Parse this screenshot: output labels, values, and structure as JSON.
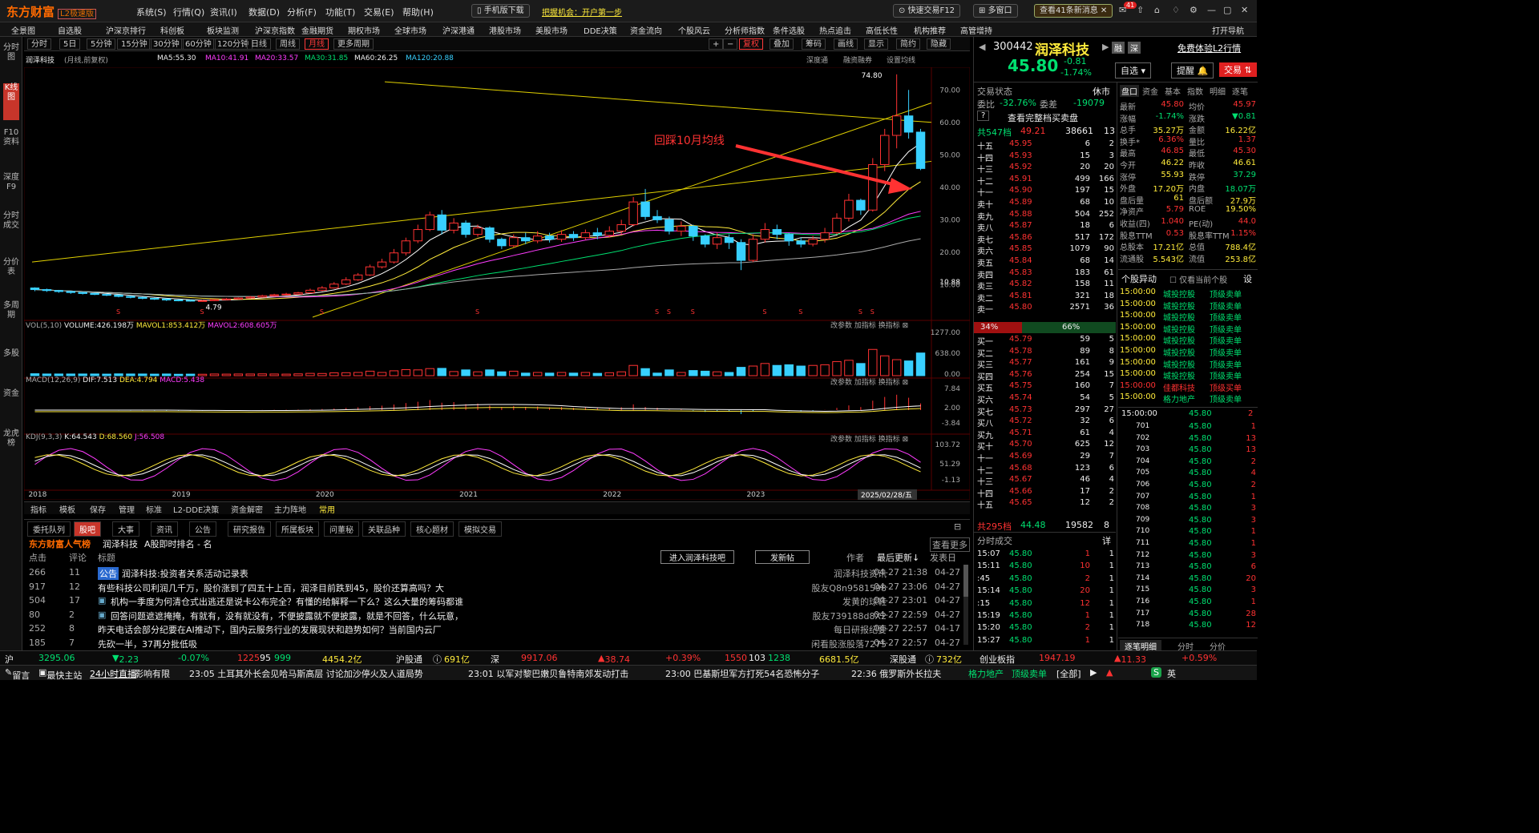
{
  "app": {
    "logo": "东方财富",
    "edition": "L2极速版"
  },
  "menus": [
    "系统(S)",
    "行情(Q)",
    "资讯(I)",
    "数据(D)",
    "分析(F)",
    "功能(T)",
    "交易(E)",
    "帮助(H)"
  ],
  "title_buttons": {
    "mobile": "手机版下载",
    "promo": "把握机会：开户第一步",
    "quick": "快速交易F12",
    "multiwin": "多窗口",
    "news": "查看41条新消息",
    "badge": "41"
  },
  "nav": [
    "全景图",
    "自选股",
    "沪深京排行",
    "科创板",
    "板块监测",
    "沪深京指数",
    "金融期货",
    "期权市场",
    "全球市场",
    "沪深港通",
    "港股市场",
    "美股市场",
    "DDE决策",
    "资金流向",
    "个股风云",
    "分析师指数",
    "条件选股",
    "热点追击",
    "高低长性",
    "机构推荐",
    "高管增持",
    "打开导航"
  ],
  "leftnav": [
    "分时图",
    "K线图",
    "F10资料",
    "深度F9",
    "分时成交",
    "分价表",
    "多周期",
    "多股",
    "资金",
    "龙虎榜"
  ],
  "periods": [
    "分时",
    "5日",
    "5分钟",
    "15分钟",
    "30分钟",
    "60分钟",
    "120分钟",
    "日线",
    "周线",
    "月线",
    "更多周期"
  ],
  "chart_tools": [
    "复权",
    "叠加",
    "筹码",
    "画线",
    "显示",
    "简约",
    "隐藏"
  ],
  "chart_sub_links": [
    "深度通",
    "融资融券",
    "设置均线"
  ],
  "ma_header": {
    "name": "润泽科技",
    "mode": "(月线,前复权)",
    "ma5": "MA5:55.30",
    "ma10": "MA10:41.91",
    "ma20": "MA20:33.57",
    "ma30": "MA30:31.85",
    "ma60": "MA60:26.25",
    "ma120": "MA120:20.88"
  },
  "vol_header": {
    "name": "VOL(5,10)",
    "vol": "VOLUME:426.198万",
    "m1": "MAVOL1:853.412万",
    "m2": "MAVOL2:608.605万"
  },
  "macd_header": {
    "name": "MACD(12,26,9)",
    "dif": "DIF:7.513",
    "dea": "DEA:4.794",
    "macd": "MACD:5.438"
  },
  "kdj_header": {
    "name": "KDJ(9,3,3)",
    "k": "K:64.543",
    "d": "D:68.560",
    "j": "J:56.508"
  },
  "panel_links": [
    "改参数",
    "加指标",
    "换指标"
  ],
  "annotation": "回踩10月均线",
  "high_label": "74.80",
  "low_label": "4.79",
  "price_axis": [
    "70.00",
    "60.00",
    "50.00",
    "40.00",
    "30.00",
    "20.00",
    "10.88",
    "10.00"
  ],
  "vol_axis": [
    "1277.00",
    "638.00",
    "0.00"
  ],
  "macd_axis": [
    "7.84",
    "2.00",
    "-3.84"
  ],
  "kdj_axis": [
    "103.72",
    "51.29",
    "-1.13"
  ],
  "years": [
    "2018",
    "2019",
    "2020",
    "2021",
    "2022",
    "2023",
    "2024"
  ],
  "cursor_date": "2025/02/28/五",
  "chart_data": {
    "type": "candlestick",
    "series_name": "润泽科技 月线",
    "ylim": [
      0,
      75
    ],
    "candles": [
      [
        9,
        8.5,
        9.2,
        8.0
      ],
      [
        8.5,
        8.2,
        8.8,
        7.8
      ],
      [
        8.2,
        7.9,
        8.4,
        7.5
      ],
      [
        7.9,
        7.6,
        8.1,
        7.2
      ],
      [
        7.6,
        7.3,
        7.8,
        7.0
      ],
      [
        7.3,
        7.0,
        7.5,
        6.8
      ],
      [
        7.0,
        6.8,
        7.2,
        6.5
      ],
      [
        6.8,
        6.4,
        7.0,
        6.1
      ],
      [
        6.4,
        6.1,
        6.6,
        5.8
      ],
      [
        6.1,
        5.8,
        6.3,
        5.5
      ],
      [
        5.8,
        5.6,
        6.0,
        5.3
      ],
      [
        5.6,
        5.3,
        5.8,
        5.0
      ],
      [
        5.3,
        5.2,
        5.5,
        4.9
      ],
      [
        5.2,
        5.0,
        5.4,
        4.8
      ],
      [
        5.0,
        5.1,
        5.3,
        4.79
      ],
      [
        5.1,
        5.4,
        5.6,
        5.0
      ],
      [
        5.4,
        5.6,
        5.9,
        5.2
      ],
      [
        5.6,
        5.9,
        6.1,
        5.4
      ],
      [
        5.9,
        6.2,
        6.5,
        5.7
      ],
      [
        6.2,
        6.6,
        6.9,
        6.0
      ],
      [
        6.6,
        6.9,
        7.2,
        6.4
      ],
      [
        6.9,
        7.1,
        7.5,
        6.7
      ],
      [
        7.1,
        7.5,
        7.8,
        6.9
      ],
      [
        7.5,
        8.3,
        8.8,
        7.3
      ],
      [
        8.3,
        9.0,
        9.6,
        8.0
      ],
      [
        9.0,
        10.2,
        10.8,
        8.8
      ],
      [
        10.2,
        11.5,
        12.3,
        9.9
      ],
      [
        11.5,
        13.0,
        13.6,
        11.2
      ],
      [
        13.0,
        15.5,
        16.2,
        12.7
      ],
      [
        15.5,
        17.0,
        18.0,
        15.0
      ],
      [
        17.0,
        19.8,
        21.0,
        16.5
      ],
      [
        19.8,
        23.5,
        24.5,
        19.0
      ],
      [
        23.5,
        27.0,
        28.5,
        22.8
      ],
      [
        27.0,
        31.5,
        32.5,
        26.5
      ],
      [
        31.5,
        26.8,
        33.0,
        25.5
      ],
      [
        26.8,
        29.0,
        30.5,
        25.8
      ],
      [
        29.0,
        25.5,
        29.8,
        24.5
      ],
      [
        25.5,
        27.5,
        28.5,
        24.8
      ],
      [
        27.5,
        24.0,
        28.0,
        23.0
      ],
      [
        24.0,
        22.0,
        24.5,
        21.0
      ],
      [
        22.0,
        24.5,
        25.5,
        21.5
      ],
      [
        24.5,
        23.5,
        26.0,
        22.5
      ],
      [
        23.5,
        25.0,
        26.5,
        22.8
      ],
      [
        25.0,
        24.0,
        26.0,
        23.0
      ],
      [
        24.0,
        25.5,
        26.8,
        23.2
      ],
      [
        25.5,
        24.5,
        26.5,
        23.5
      ],
      [
        24.5,
        26.0,
        27.0,
        23.8
      ],
      [
        26.0,
        25.2,
        27.5,
        24.0
      ],
      [
        25.2,
        26.5,
        28.0,
        24.5
      ],
      [
        26.5,
        28.5,
        30.0,
        25.5
      ],
      [
        28.5,
        35.5,
        37.0,
        28.0
      ],
      [
        35.5,
        31.0,
        39.5,
        30.0
      ],
      [
        31.0,
        30.0,
        33.0,
        29.0
      ],
      [
        30.0,
        26.5,
        31.0,
        25.5
      ],
      [
        26.5,
        28.0,
        29.5,
        25.0
      ],
      [
        28.0,
        25.0,
        28.5,
        23.5
      ],
      [
        25.0,
        22.5,
        25.5,
        21.5
      ],
      [
        22.5,
        24.5,
        26.0,
        21.0
      ],
      [
        24.5,
        23.0,
        25.5,
        21.0
      ],
      [
        23.0,
        17.5,
        24.0,
        14.5
      ],
      [
        17.5,
        24.0,
        25.5,
        17.0
      ],
      [
        24.0,
        27.0,
        29.0,
        23.0
      ],
      [
        27.0,
        25.5,
        28.5,
        24.0
      ],
      [
        25.5,
        23.5,
        26.0,
        22.0
      ],
      [
        23.5,
        22.5,
        24.5,
        21.5
      ],
      [
        22.5,
        24.0,
        25.0,
        21.8
      ],
      [
        24.0,
        26.0,
        27.5,
        23.0
      ],
      [
        26.0,
        30.5,
        32.0,
        25.5
      ],
      [
        30.5,
        36.0,
        38.0,
        29.5
      ],
      [
        36.0,
        33.0,
        36.5,
        31.5
      ],
      [
        33.0,
        47.0,
        49.0,
        32.5
      ],
      [
        47.0,
        56.0,
        58.0,
        45.0
      ],
      [
        56.0,
        62.0,
        74.8,
        52.0
      ],
      [
        62.0,
        57.0,
        70.0,
        55.0
      ],
      [
        57.0,
        45.8,
        58.0,
        45.3
      ]
    ]
  },
  "bottom_tabs": [
    "指标",
    "模板",
    "保存",
    "管理",
    "标准",
    "L2-DDE决策",
    "资金解密",
    "主力阵地",
    "常用"
  ],
  "news_tabs": [
    "委托队列",
    "股吧",
    "大事",
    "资讯",
    "公告",
    "研究报告",
    "所属板块",
    "问董秘",
    "关联品种",
    "核心题材",
    "模拟交易"
  ],
  "news_header": {
    "brand": "东方财富人气榜",
    "stock": "润泽科技",
    "rank": "A股即时排名 - 名",
    "more": "查看更多",
    "enter": "进入润泽科技吧",
    "post": "发新帖",
    "cols": [
      "点击",
      "评论",
      "标题",
      "作者",
      "最后更新↓",
      "发表日"
    ]
  },
  "news": [
    {
      "click": "266",
      "comment": "11",
      "tag": "公告",
      "title": "润泽科技:投资者关系活动记录表",
      "author": "润泽科技资讯",
      "updated": "04-27 21:38",
      "date": "04-27"
    },
    {
      "click": "917",
      "comment": "12",
      "tag": "",
      "title": "有些科技公司利润几千万，股价涨到了四五十上百，润泽目前跌到45，股价还算高吗？大",
      "author": "股友Q8n9581598",
      "updated": "04-27 23:06",
      "date": "04-27"
    },
    {
      "click": "504",
      "comment": "17",
      "tag": "img",
      "title": "机构一季度为何清仓式出逃还是说卡公布完全？有懂的给解释一下么？这么大量的筹码都谁",
      "author": "发黄的球鞋",
      "updated": "04-27 23:01",
      "date": "04-27"
    },
    {
      "click": "80",
      "comment": "2",
      "tag": "img",
      "title": "回答问题遮遮掩掩，有就有，没有就没有，不便披露就不便披露，就是不回答，什么玩意，",
      "author": "股友739188d8X2",
      "updated": "04-27 22:59",
      "date": "04-27"
    },
    {
      "click": "252",
      "comment": "8",
      "tag": "",
      "title": "昨天电话会部分纪要在AI推动下，国内云服务行业的发展现状和趋势如何？当前国内云厂",
      "author": "每日研报纪要",
      "updated": "04-27 22:57",
      "date": "04-17"
    },
    {
      "click": "185",
      "comment": "7",
      "tag": "",
      "title": "先砍一半，37再分批低吸",
      "author": "闲看股涨股落7275",
      "updated": "04-27 22:57",
      "date": "04-27"
    }
  ],
  "stock": {
    "code": "300442",
    "name": "润泽科技",
    "price": "45.80",
    "change": "-0.81",
    "pct": "-1.74%",
    "tags": [
      "融",
      "深"
    ],
    "btn_zixuan": "自选",
    "btn_tixing": "提醒",
    "btn_jiaoyi": "交易",
    "free_l2": "免费体验L2行情",
    "status": "交易状态",
    "status_val": "休市",
    "weibi": "委比",
    "weibi_val": "-32.76%",
    "weicha": "委差",
    "weicha_val": "-19079",
    "full_book": "查看完整档买卖盘",
    "total_sell": "共547档",
    "ts_price": "49.21",
    "ts_vol": "38661",
    "ts_n": "13",
    "total_buy": "共295档",
    "tb_price": "44.48",
    "tb_vol": "19582",
    "tb_n": "8",
    "ratio_sell": "34%",
    "ratio_buy": "66%"
  },
  "sells": [
    [
      "十五",
      "45.95",
      "6",
      "2"
    ],
    [
      "十四",
      "45.93",
      "15",
      "3"
    ],
    [
      "十三",
      "45.92",
      "20",
      "20"
    ],
    [
      "十二",
      "45.91",
      "499",
      "166"
    ],
    [
      "十一",
      "45.90",
      "197",
      "15"
    ],
    [
      "卖十",
      "45.89",
      "68",
      "10"
    ],
    [
      "卖九",
      "45.88",
      "504",
      "252"
    ],
    [
      "卖八",
      "45.87",
      "18",
      "6"
    ],
    [
      "卖七",
      "45.86",
      "517",
      "172"
    ],
    [
      "卖六",
      "45.85",
      "1079",
      "90"
    ],
    [
      "卖五",
      "45.84",
      "68",
      "14"
    ],
    [
      "卖四",
      "45.83",
      "183",
      "61"
    ],
    [
      "卖三",
      "45.82",
      "158",
      "11"
    ],
    [
      "卖二",
      "45.81",
      "321",
      "18"
    ],
    [
      "卖一",
      "45.80",
      "2571",
      "36"
    ]
  ],
  "buys": [
    [
      "买一",
      "45.79",
      "59",
      "5"
    ],
    [
      "买二",
      "45.78",
      "89",
      "8"
    ],
    [
      "买三",
      "45.77",
      "161",
      "9"
    ],
    [
      "买四",
      "45.76",
      "254",
      "15"
    ],
    [
      "买五",
      "45.75",
      "160",
      "7"
    ],
    [
      "买六",
      "45.74",
      "54",
      "5"
    ],
    [
      "买七",
      "45.73",
      "297",
      "27"
    ],
    [
      "买八",
      "45.72",
      "32",
      "6"
    ],
    [
      "买九",
      "45.71",
      "61",
      "4"
    ],
    [
      "买十",
      "45.70",
      "625",
      "12"
    ],
    [
      "十一",
      "45.69",
      "29",
      "7"
    ],
    [
      "十二",
      "45.68",
      "123",
      "6"
    ],
    [
      "十三",
      "45.67",
      "46",
      "4"
    ],
    [
      "十四",
      "45.66",
      "17",
      "2"
    ],
    [
      "十五",
      "45.65",
      "12",
      "2"
    ]
  ],
  "quote_tabs": [
    "盘口",
    "资金",
    "基本",
    "指数",
    "明细",
    "逐笔"
  ],
  "quote": [
    [
      "最新",
      "45.80",
      "均价",
      "45.97"
    ],
    [
      "涨幅",
      "-1.74%",
      "涨跌",
      "▼0.81"
    ],
    [
      "总手",
      "35.27万",
      "金额",
      "16.22亿"
    ],
    [
      "换手*",
      "6.36%",
      "量比",
      "1.37"
    ],
    [
      "最高",
      "46.85",
      "最低",
      "45.30"
    ],
    [
      "今开",
      "46.22",
      "昨收",
      "46.61"
    ],
    [
      "涨停",
      "55.93",
      "跌停",
      "37.29"
    ],
    [
      "外盘",
      "17.20万",
      "内盘",
      "18.07万"
    ],
    [
      "盘后量",
      "61",
      "盘后额",
      "27.9万"
    ],
    [
      "净资产",
      "5.79",
      "ROE",
      "19.50%"
    ],
    [
      "收益(四)",
      "1.040",
      "PE(动)",
      "44.0"
    ],
    [
      "股息TTM",
      "0.53",
      "股息率TTM",
      "1.15%"
    ],
    [
      "总股本",
      "17.21亿",
      "总值",
      "788.4亿"
    ],
    [
      "流通股",
      "5.543亿",
      "流值",
      "253.8亿"
    ]
  ],
  "anomaly": {
    "title": "个股异动",
    "opt": "仅看当前个股",
    "set": "设",
    "rows": [
      [
        "15:00:00",
        "城投控股",
        "顶级卖单"
      ],
      [
        "15:00:00",
        "城投控股",
        "顶级卖单"
      ],
      [
        "15:00:00",
        "城投控股",
        "顶级卖单"
      ],
      [
        "15:00:00",
        "城投控股",
        "顶级卖单"
      ],
      [
        "15:00:00",
        "城投控股",
        "顶级卖单"
      ],
      [
        "15:00:00",
        "城投控股",
        "顶级卖单"
      ],
      [
        "15:00:00",
        "城投控股",
        "顶级卖单"
      ],
      [
        "15:00:00",
        "城投控股",
        "顶级卖单"
      ],
      [
        "15:00:00",
        "佳都科技",
        "顶级买单"
      ],
      [
        "15:00:00",
        "格力地产",
        "顶级卖单"
      ]
    ]
  },
  "ticks_head": {
    "time": "15:00:00",
    "price": "45.80",
    "vol": "2"
  },
  "ticks": [
    [
      "701",
      "45.80",
      "1"
    ],
    [
      "702",
      "45.80",
      "13"
    ],
    [
      "703",
      "45.80",
      "13"
    ],
    [
      "704",
      "45.80",
      "2"
    ],
    [
      "705",
      "45.80",
      "4"
    ],
    [
      "706",
      "45.80",
      "2"
    ],
    [
      "707",
      "45.80",
      "1"
    ],
    [
      "708",
      "45.80",
      "3"
    ],
    [
      "709",
      "45.80",
      "3"
    ],
    [
      "710",
      "45.80",
      "1"
    ],
    [
      "711",
      "45.80",
      "1"
    ],
    [
      "712",
      "45.80",
      "3"
    ],
    [
      "713",
      "45.80",
      "6"
    ],
    [
      "714",
      "45.80",
      "20"
    ],
    [
      "715",
      "45.80",
      "3"
    ],
    [
      "716",
      "45.80",
      "1"
    ],
    [
      "717",
      "45.80",
      "28"
    ],
    [
      "718",
      "45.80",
      "12"
    ]
  ],
  "fenshi": {
    "title": "分时成交",
    "detail": "详",
    "rows": [
      [
        "15:07",
        "45.80",
        "1",
        "1"
      ],
      [
        "15:11",
        "45.80",
        "10",
        "1"
      ],
      [
        ":45",
        "45.80",
        "2",
        "1"
      ],
      [
        "15:14",
        "45.80",
        "20",
        "1"
      ],
      [
        ":15",
        "45.80",
        "12",
        "1"
      ],
      [
        "15:19",
        "45.80",
        "1",
        "1"
      ],
      [
        "15:20",
        "45.80",
        "2",
        "1"
      ],
      [
        "15:27",
        "45.80",
        "1",
        "1"
      ]
    ]
  },
  "right_bottom_tabs": [
    "逐笔明细",
    "分时",
    "分价"
  ],
  "status": {
    "sh": "沪",
    "sh_idx": "3295.06",
    "sh_chg": "2.23",
    "sh_pct": "-0.07%",
    "sh_up": "1225",
    "sh_mid": "95",
    "sh_dn": "999",
    "sh_amt": "4454.2亿",
    "hgt": "沪股通",
    "hgt_amt": "691亿",
    "sz": "深",
    "sz_idx": "9917.06",
    "sz_chg": "38.74",
    "sz_pct": "+0.39%",
    "sz_up": "1550",
    "sz_mid": "103",
    "sz_dn": "1238",
    "sz_amt": "6681.5亿",
    "sgt": "深股通",
    "sgt_amt": "732亿",
    "cyb": "创业板指",
    "cyb_idx": "1947.19",
    "cyb_chg": "11.33",
    "cyb_pct": "+0.59%"
  },
  "ticker": {
    "msg": "留言",
    "hz": "最快主站",
    "live": "24小时直播",
    "yx": "影响有限",
    "items": [
      "23:05 土耳其外长会见哈马斯高层 讨论加沙停火及人道局势",
      "23:01 以军对黎巴嫩贝鲁特南郊发动打击",
      "23:00 巴基斯坦军方打死54名恐怖分子",
      "22:36 俄罗斯外长拉夫"
    ],
    "stock": "格力地产",
    "signal": "顶级卖单",
    "all": "[全部]",
    "ime": "英"
  }
}
